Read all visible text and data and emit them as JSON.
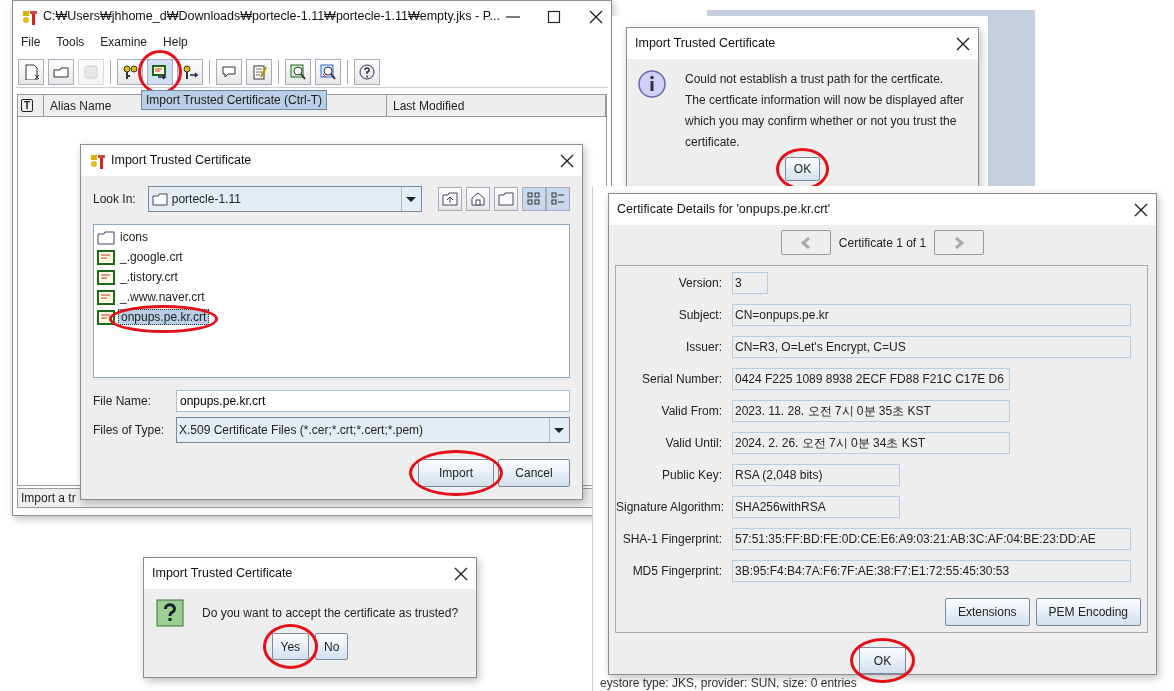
{
  "main_window": {
    "title": "C:₩Users₩jhhome_d₩Downloads₩portecle-1.11₩portecle-1.11₩empty.jks - P...",
    "menu": [
      {
        "label": "File"
      },
      {
        "label": "Tools"
      },
      {
        "label": "Examine"
      },
      {
        "label": "Help"
      }
    ],
    "toolbar_groups": [
      [
        {
          "disabled": false,
          "circled": false
        },
        {
          "disabled": false,
          "circled": false
        },
        {
          "disabled": true,
          "circled": false
        }
      ],
      [
        {
          "disabled": false,
          "circled": false
        },
        {
          "disabled": false,
          "circled": true
        },
        {
          "disabled": false,
          "circled": false
        }
      ],
      [
        {
          "disabled": false,
          "circled": false
        },
        {
          "disabled": false,
          "circled": false
        }
      ],
      [
        {
          "disabled": false,
          "circled": false
        },
        {
          "disabled": false,
          "circled": false
        }
      ],
      [
        {
          "disabled": false,
          "circled": false
        }
      ]
    ],
    "tooltip": "Import Trusted Certificate (Ctrl-T)",
    "columns": [
      {
        "label": "T",
        "kind": "type"
      },
      {
        "label": "Alias Name",
        "kind": "text"
      },
      {
        "label": "Last Modified",
        "kind": "text"
      }
    ],
    "status_bar": "Import a tr"
  },
  "file_dialog": {
    "title": "Import Trusted Certificate",
    "look_in": {
      "label": "Look In:",
      "value": "portecle-1.11"
    },
    "files": [
      {
        "name": "icons",
        "kind": "folder",
        "selected": false,
        "circled": false
      },
      {
        "name": "_.google.crt",
        "kind": "cert",
        "selected": false,
        "circled": false
      },
      {
        "name": "_.tistory.crt",
        "kind": "cert",
        "selected": false,
        "circled": false
      },
      {
        "name": "_.www.naver.crt",
        "kind": "cert",
        "selected": false,
        "circled": false
      },
      {
        "name": "onpups.pe.kr.crt",
        "kind": "cert",
        "selected": true,
        "circled": true
      }
    ],
    "file_name": {
      "label": "File Name:",
      "value": "onpups.pe.kr.crt"
    },
    "file_type": {
      "label": "Files of Type:",
      "value": "X.509 Certificate Files (*.cer;*.crt;*.cert;*.pem)"
    },
    "buttons": [
      {
        "label": "Import",
        "circled": true
      },
      {
        "label": "Cancel",
        "circled": false
      }
    ]
  },
  "info_dialog": {
    "title": "Import Trusted Certificate",
    "message_lines": [
      "Could not establish a trust path for the certficate.",
      "The certficate information will now be displayed after",
      "which you may confirm whether or not you trust the",
      "certificate."
    ],
    "button": {
      "label": "OK",
      "circled": true
    }
  },
  "background_window": {
    "status_bar": "eystore type: JKS, provider: SUN, size: 0 entries"
  },
  "cert_dialog": {
    "title": "Certificate Details for 'onpups.pe.kr.crt'",
    "navigator": "Certificate 1 of 1",
    "fields": [
      {
        "label": "Version:",
        "value": "3"
      },
      {
        "label": "Subject:",
        "value": "CN=onpups.pe.kr"
      },
      {
        "label": "Issuer:",
        "value": "CN=R3, O=Let's Encrypt, C=US"
      },
      {
        "label": "Serial Number:",
        "value": "0424 F225 1089 8938 2ECF FD88 F21C C17E D6"
      },
      {
        "label": "Valid From:",
        "value": "2023. 11. 28. 오전 7시 0분 35초 KST"
      },
      {
        "label": "Valid Until:",
        "value": "2024. 2. 26. 오전 7시 0분 34초 KST"
      },
      {
        "label": "Public Key:",
        "value": "RSA (2,048 bits)"
      },
      {
        "label": "Signature Algorithm:",
        "value": "SHA256withRSA"
      },
      {
        "label": "SHA-1 Fingerprint:",
        "value": "57:51:35:FF:BD:FE:0D:CE:E6:A9:03:21:AB:3C:AF:04:BE:23:DD:AE"
      },
      {
        "label": "MD5 Fingerprint:",
        "value": "3B:95:F4:B4:7A:F6:7F:AE:38:F7:E1:72:55:45:30:53"
      }
    ],
    "buttons": [
      {
        "label": "Extensions"
      },
      {
        "label": "PEM Encoding"
      }
    ],
    "ok_button": {
      "label": "OK",
      "circled": true
    }
  },
  "question_dialog": {
    "title": "Import Trusted Certificate",
    "message": "Do you want to accept the certificate as trusted?",
    "buttons": [
      {
        "label": "Yes",
        "circled": true
      },
      {
        "label": "No",
        "circled": false
      }
    ]
  }
}
